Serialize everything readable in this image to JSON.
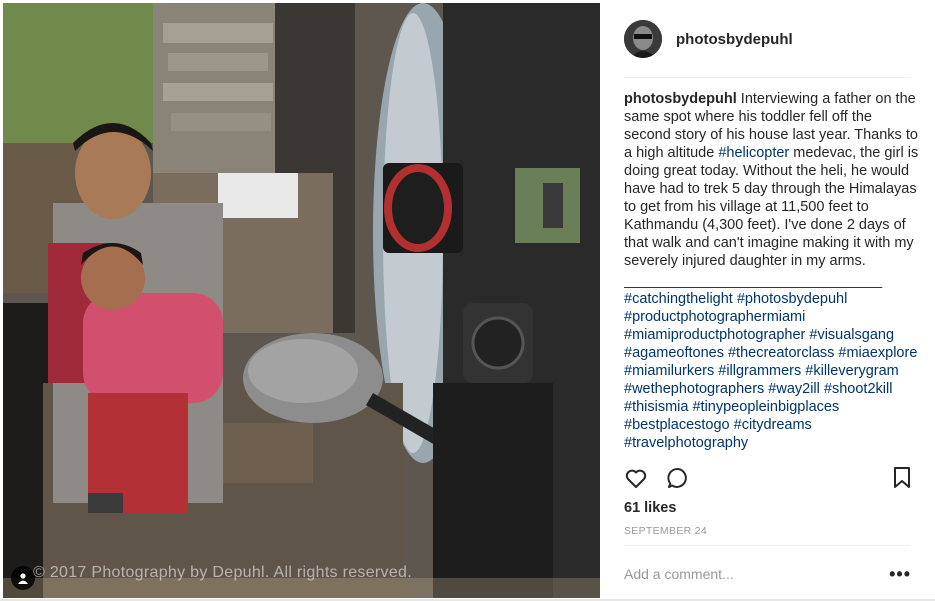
{
  "post": {
    "username": "photosbydepuhl",
    "caption_user": "photosbydepuhl",
    "caption_part1": " Interviewing a father on the same spot where his toddler fell off the second story of his house last year. Thanks to a high altitude ",
    "caption_link": "#helicopter",
    "caption_part2": " medevac, the girl is doing great today. Without the heli, he would have had to trek 5 day through the Himalayas to get from his village at 11,500 feet to Kathmandu (4,300 feet). I've done 2 days of that walk and can't imagine making it with my severely injured daughter in my arms.",
    "caption_rule": "________________________________",
    "hashtags": "#catchingthelight #photosbydepuhl #productphotographermiami #miamiproductphotographer #visualsgang #agameoftones #thecreatorclass #miaexplore #miamilurkers #illgrammers #killeverygram #wethephotographers #way2ill #shoot2kill #thisismia #tinypeopleinbigplaces #bestplacestogo #citydreams #travelphotography",
    "likes": "61 likes",
    "date": "SEPTEMBER 24",
    "comment_placeholder": "Add a comment...",
    "more_label": "•••",
    "watermark": "© 2017 Photography by Depuhl. All rights reserved."
  },
  "icons": {
    "like": "heart-icon",
    "comment": "comment-icon",
    "save": "bookmark-icon",
    "tag": "person-tag-icon",
    "more": "more-options-icon"
  },
  "colors": {
    "text": "#262626",
    "link": "#003569",
    "muted": "#999999",
    "divider": "#efefef"
  }
}
